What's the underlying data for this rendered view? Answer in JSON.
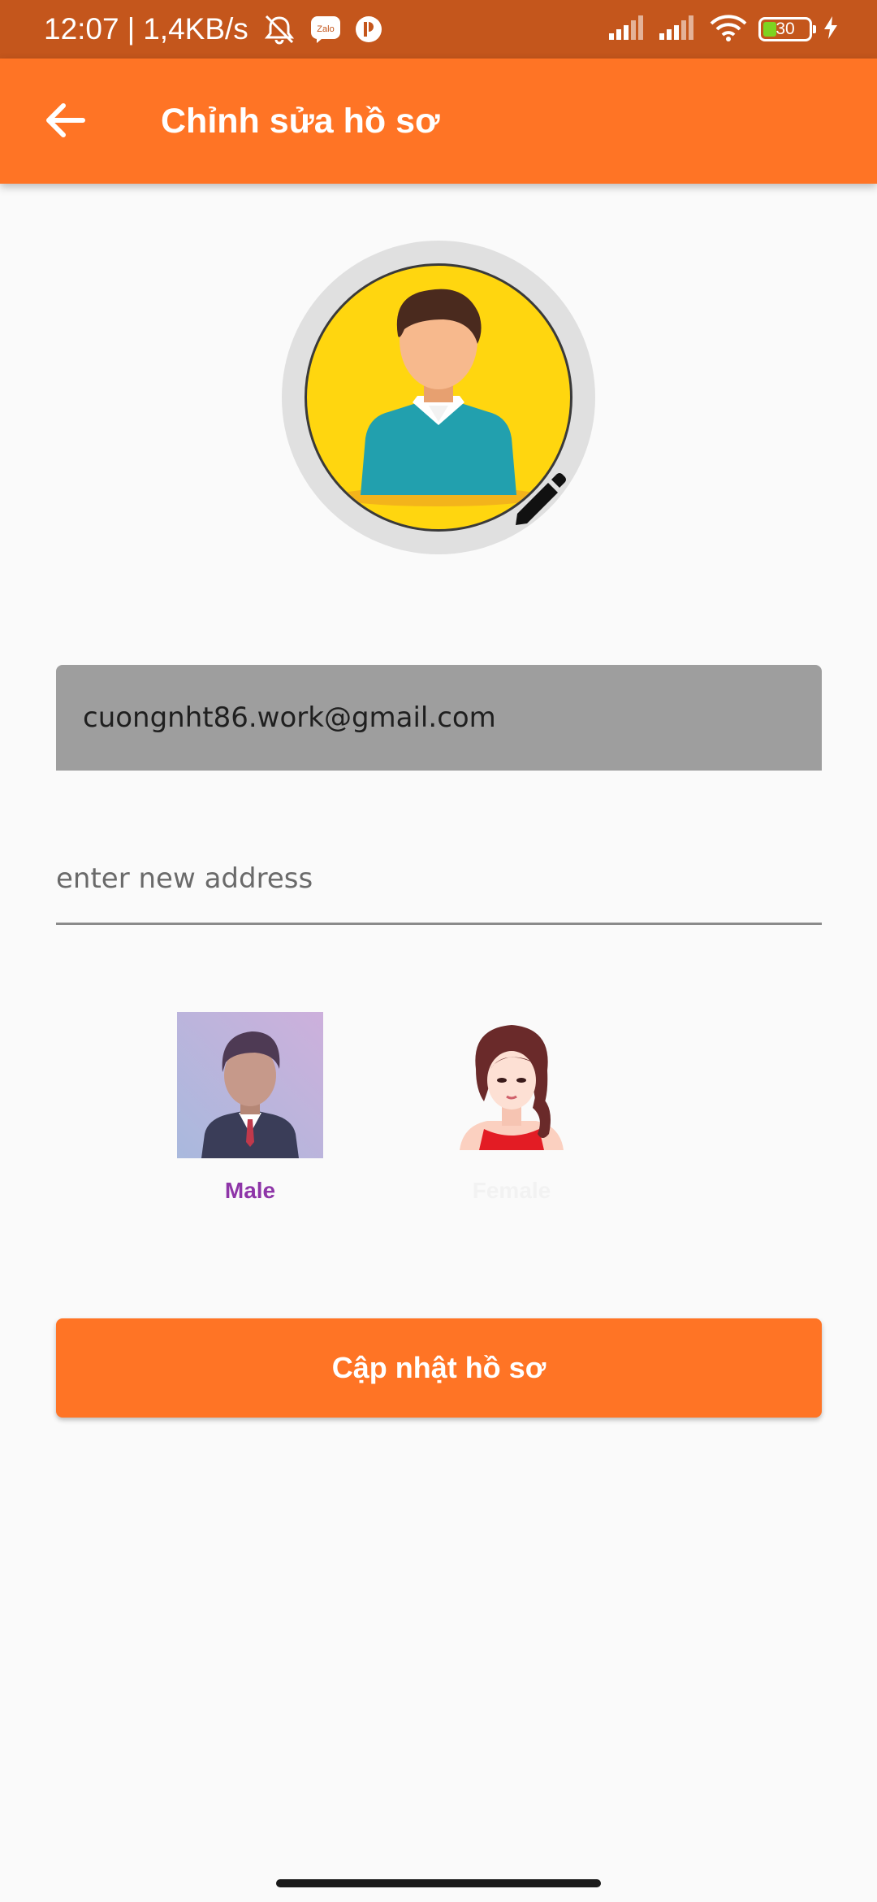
{
  "status_bar": {
    "time": "12:07",
    "separator": "|",
    "net_speed": "1,4KB/s",
    "icons": [
      "bell-muted-icon",
      "zalo-icon",
      "app-notification-icon",
      "signal-icon",
      "signal-icon",
      "wifi-icon",
      "battery-icon",
      "charging-icon"
    ],
    "zalo_text": "Zalo",
    "battery_level": "30",
    "battery_fraction": 0.3
  },
  "app_bar": {
    "title": "Chỉnh sửa hồ sơ",
    "back_icon": "arrow-back-icon"
  },
  "profile": {
    "avatar_icon": "person-avatar-icon",
    "edit_icon": "pencil-icon",
    "email": "cuongnht86.work@gmail.com",
    "address_placeholder": "enter new address",
    "address_value": ""
  },
  "gender": {
    "male_label": "Male",
    "female_label": "Female",
    "selected": "male"
  },
  "actions": {
    "update_label": "Cập nhật hồ sơ"
  },
  "colors": {
    "status_bar": "#c4561c",
    "primary": "#ff7425",
    "selected_label": "#8e35a8",
    "email_field_bg": "#9e9e9e"
  }
}
